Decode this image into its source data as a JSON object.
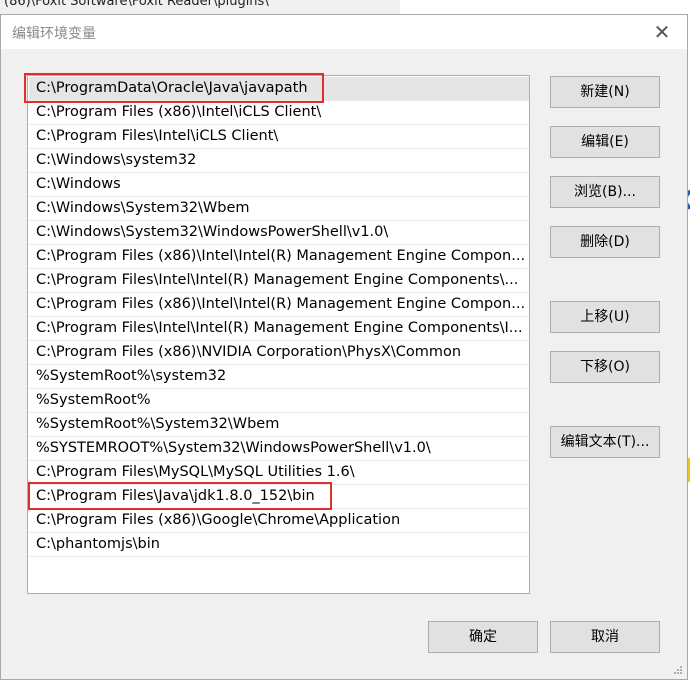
{
  "background": {
    "path_fragment": "(86)\\Foxit Software\\Foxit Reader\\plugins\\"
  },
  "dialog": {
    "title": "编辑环境变量",
    "close_icon": "close-icon"
  },
  "paths": [
    "C:\\ProgramData\\Oracle\\Java\\javapath",
    "C:\\Program Files (x86)\\Intel\\iCLS Client\\",
    "C:\\Program Files\\Intel\\iCLS Client\\",
    "C:\\Windows\\system32",
    "C:\\Windows",
    "C:\\Windows\\System32\\Wbem",
    "C:\\Windows\\System32\\WindowsPowerShell\\v1.0\\",
    "C:\\Program Files (x86)\\Intel\\Intel(R) Management Engine Compon...",
    "C:\\Program Files\\Intel\\Intel(R) Management Engine Components\\...",
    "C:\\Program Files (x86)\\Intel\\Intel(R) Management Engine Compon...",
    "C:\\Program Files\\Intel\\Intel(R) Management Engine Components\\I...",
    "C:\\Program Files (x86)\\NVIDIA Corporation\\PhysX\\Common",
    "%SystemRoot%\\system32",
    "%SystemRoot%",
    "%SystemRoot%\\System32\\Wbem",
    "%SYSTEMROOT%\\System32\\WindowsPowerShell\\v1.0\\",
    "C:\\Program Files\\MySQL\\MySQL Utilities 1.6\\",
    "C:\\Program Files\\Java\\jdk1.8.0_152\\bin",
    "C:\\Program Files (x86)\\Google\\Chrome\\Application",
    "C:\\phantomjs\\bin"
  ],
  "selected_index": 0,
  "buttons": {
    "new": "新建(N)",
    "edit": "编辑(E)",
    "browse": "浏览(B)...",
    "delete": "删除(D)",
    "move_up": "上移(U)",
    "move_down": "下移(O)",
    "edit_text": "编辑文本(T)...",
    "ok": "确定",
    "cancel": "取消"
  },
  "colors": {
    "highlight_box": "#e0302c",
    "selected_row": "#e5e5e5",
    "dialog_bg": "#f0f0f0"
  }
}
